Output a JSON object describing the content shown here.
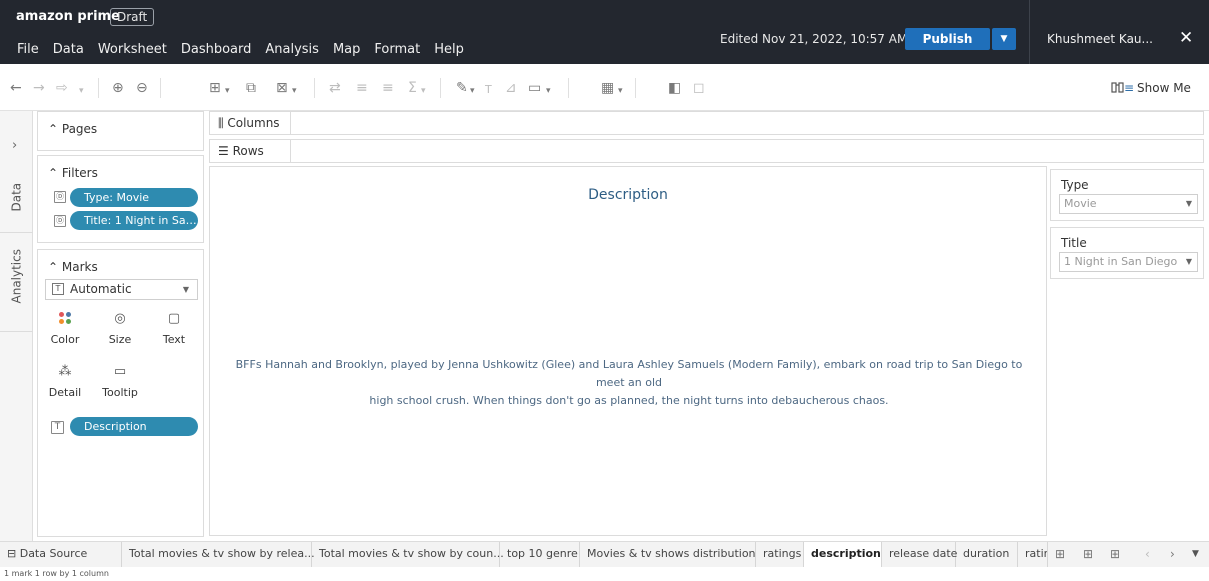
{
  "app": {
    "brand": "amazon prime",
    "draft": "Draft",
    "edited": "Edited Nov 21, 2022, 10:57 AM",
    "publish": "Publish",
    "user": "Khushmeet Kau...",
    "close": "✕"
  },
  "menu": [
    "File",
    "Data",
    "Worksheet",
    "Dashboard",
    "Analysis",
    "Map",
    "Format",
    "Help"
  ],
  "toolbar": {
    "show_me": "Show Me"
  },
  "side_tabs": {
    "data": "Data",
    "analytics": "Analytics"
  },
  "pages": {
    "title": "Pages"
  },
  "filters": {
    "title": "Filters",
    "pills": [
      "Type: Movie",
      "Title: 1 Night in San ..."
    ]
  },
  "marks": {
    "title": "Marks",
    "type": "Automatic",
    "buttons": {
      "color": "Color",
      "size": "Size",
      "text": "Text",
      "detail": "Detail",
      "tooltip": "Tooltip"
    },
    "pill": "Description"
  },
  "shelves": {
    "columns": "Columns",
    "rows": "Rows"
  },
  "view": {
    "title": "Description",
    "text_line1": "BFFs Hannah and Brooklyn, played by Jenna Ushkowitz (Glee) and Laura Ashley Samuels (Modern Family), embark on road trip to San Diego to meet an old",
    "text_line2": "high school crush. When things don't go as planned, the night turns into debaucherous chaos."
  },
  "quick_filters": [
    {
      "title": "Type",
      "value": "Movie"
    },
    {
      "title": "Title",
      "value": "1 Night in San Diego"
    }
  ],
  "tabs": [
    "Data Source",
    "Total movies & tv show by relea...",
    "Total movies & tv show by coun...",
    "top 10 genre",
    "Movies & tv shows distribution",
    "ratings",
    "description",
    "release date",
    "duration",
    "ratin"
  ],
  "active_tab": "description",
  "status": "1 mark   1 row by 1 column",
  "colors": {
    "pill": "#2e8bb0",
    "publish": "#1f6fba",
    "topbar": "#23272f"
  }
}
